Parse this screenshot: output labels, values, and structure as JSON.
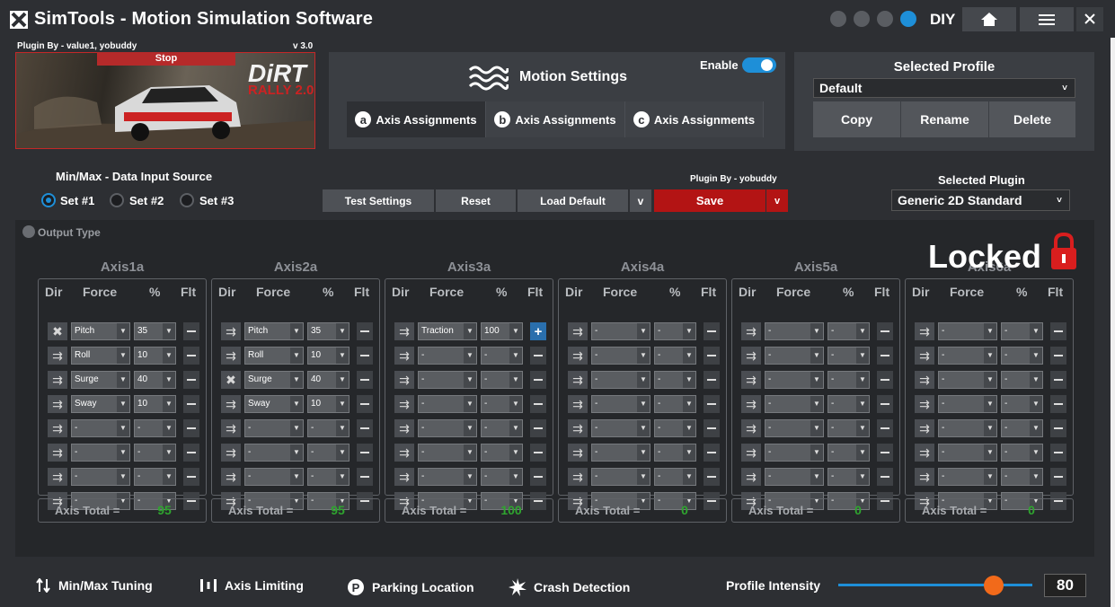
{
  "window": {
    "title": "SimTools - Motion Simulation Software",
    "mode_label": "DIY",
    "accent_color": "#1e8fd8",
    "danger_color": "#b31414"
  },
  "plugin_banner": {
    "plugin_by": "Plugin By - value1, yobuddy",
    "version": "v 3.0",
    "stop_label": "Stop",
    "game_logo_top": "DiRT",
    "game_logo_bottom": "RALLY 2.0"
  },
  "motion_settings": {
    "title": "Motion Settings",
    "enable_label": "Enable",
    "enabled": true,
    "tabs": [
      {
        "badge": "a",
        "label": "Axis Assignments"
      },
      {
        "badge": "b",
        "label": "Axis Assignments"
      },
      {
        "badge": "c",
        "label": "Axis Assignments"
      }
    ]
  },
  "profile": {
    "title": "Selected Profile",
    "selected": "Default",
    "buttons": {
      "copy": "Copy",
      "rename": "Rename",
      "delete": "Delete"
    }
  },
  "input_source": {
    "label": "Min/Max - Data Input Source",
    "options": [
      "Set #1",
      "Set #2",
      "Set #3"
    ],
    "selected": "Set #1"
  },
  "actions": {
    "test": "Test Settings",
    "reset": "Reset",
    "load_default": "Load Default",
    "dropdown": "v",
    "plugin_by": "Plugin By - yobuddy",
    "save": "Save"
  },
  "selected_plugin": {
    "label": "Selected Plugin",
    "value": "Generic 2D Standard"
  },
  "output": {
    "label": "Output Type",
    "locked_label": "Locked",
    "headers": {
      "dir": "Dir",
      "force": "Force",
      "pct": "%",
      "flt": "Flt"
    },
    "total_label": "Axis Total =",
    "axes": [
      {
        "name": "Axis1a",
        "total": "95",
        "rows": [
          {
            "force": "Pitch",
            "pct": "35",
            "dir": "cross"
          },
          {
            "force": "Roll",
            "pct": "10",
            "dir": "arrow"
          },
          {
            "force": "Surge",
            "pct": "40",
            "dir": "arrow"
          },
          {
            "force": "Sway",
            "pct": "10",
            "dir": "arrow"
          },
          {
            "force": "-",
            "pct": "-",
            "dir": "arrow"
          },
          {
            "force": "-",
            "pct": "-",
            "dir": "arrow"
          },
          {
            "force": "-",
            "pct": "-",
            "dir": "arrow"
          },
          {
            "force": "-",
            "pct": "-",
            "dir": "arrow"
          }
        ]
      },
      {
        "name": "Axis2a",
        "total": "95",
        "rows": [
          {
            "force": "Pitch",
            "pct": "35",
            "dir": "arrow"
          },
          {
            "force": "Roll",
            "pct": "10",
            "dir": "arrow"
          },
          {
            "force": "Surge",
            "pct": "40",
            "dir": "cross"
          },
          {
            "force": "Sway",
            "pct": "10",
            "dir": "arrow"
          },
          {
            "force": "-",
            "pct": "-",
            "dir": "arrow"
          },
          {
            "force": "-",
            "pct": "-",
            "dir": "arrow"
          },
          {
            "force": "-",
            "pct": "-",
            "dir": "arrow"
          },
          {
            "force": "-",
            "pct": "-",
            "dir": "arrow"
          }
        ]
      },
      {
        "name": "Axis3a",
        "total": "100",
        "rows": [
          {
            "force": "Traction",
            "pct": "100",
            "dir": "arrow",
            "flt": "plus"
          },
          {
            "force": "-",
            "pct": "-",
            "dir": "arrow"
          },
          {
            "force": "-",
            "pct": "-",
            "dir": "arrow"
          },
          {
            "force": "-",
            "pct": "-",
            "dir": "arrow"
          },
          {
            "force": "-",
            "pct": "-",
            "dir": "arrow"
          },
          {
            "force": "-",
            "pct": "-",
            "dir": "arrow"
          },
          {
            "force": "-",
            "pct": "-",
            "dir": "arrow"
          },
          {
            "force": "-",
            "pct": "-",
            "dir": "arrow"
          }
        ]
      },
      {
        "name": "Axis4a",
        "total": "0",
        "rows": [
          {
            "force": "-",
            "pct": "-",
            "dir": "arrow"
          },
          {
            "force": "-",
            "pct": "-",
            "dir": "arrow"
          },
          {
            "force": "-",
            "pct": "-",
            "dir": "arrow"
          },
          {
            "force": "-",
            "pct": "-",
            "dir": "arrow"
          },
          {
            "force": "-",
            "pct": "-",
            "dir": "arrow"
          },
          {
            "force": "-",
            "pct": "-",
            "dir": "arrow"
          },
          {
            "force": "-",
            "pct": "-",
            "dir": "arrow"
          },
          {
            "force": "-",
            "pct": "-",
            "dir": "arrow"
          }
        ]
      },
      {
        "name": "Axis5a",
        "total": "0",
        "rows": [
          {
            "force": "-",
            "pct": "-",
            "dir": "arrow"
          },
          {
            "force": "-",
            "pct": "-",
            "dir": "arrow"
          },
          {
            "force": "-",
            "pct": "-",
            "dir": "arrow"
          },
          {
            "force": "-",
            "pct": "-",
            "dir": "arrow"
          },
          {
            "force": "-",
            "pct": "-",
            "dir": "arrow"
          },
          {
            "force": "-",
            "pct": "-",
            "dir": "arrow"
          },
          {
            "force": "-",
            "pct": "-",
            "dir": "arrow"
          },
          {
            "force": "-",
            "pct": "-",
            "dir": "arrow"
          }
        ]
      },
      {
        "name": "Axis6a",
        "total": "0",
        "rows": [
          {
            "force": "-",
            "pct": "-",
            "dir": "arrow"
          },
          {
            "force": "-",
            "pct": "-",
            "dir": "arrow"
          },
          {
            "force": "-",
            "pct": "-",
            "dir": "arrow"
          },
          {
            "force": "-",
            "pct": "-",
            "dir": "arrow"
          },
          {
            "force": "-",
            "pct": "-",
            "dir": "arrow"
          },
          {
            "force": "-",
            "pct": "-",
            "dir": "arrow"
          },
          {
            "force": "-",
            "pct": "-",
            "dir": "arrow"
          },
          {
            "force": "-",
            "pct": "-",
            "dir": "arrow"
          }
        ]
      }
    ]
  },
  "bottom": {
    "items": [
      {
        "icon": "minmax-arrows-icon",
        "label": "Min/Max Tuning"
      },
      {
        "icon": "axis-limit-icon",
        "label": "Axis Limiting"
      },
      {
        "icon": "parking-icon",
        "label": "Parking Location"
      },
      {
        "icon": "crash-burst-icon",
        "label": "Crash Detection"
      }
    ],
    "intensity_label": "Profile Intensity",
    "intensity_value": "80",
    "intensity_fraction": 0.8
  }
}
